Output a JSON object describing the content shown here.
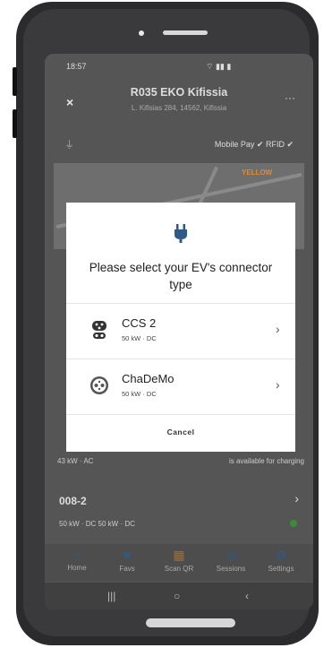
{
  "status": {
    "time": "18:57",
    "right_icons": "wifi-signal-battery"
  },
  "header": {
    "title": "R035 EKO Kifissia",
    "subtitle": "L. Kifisias 284, 14562, Kifissia",
    "close_label": "×",
    "more_label": "···"
  },
  "payments": {
    "text": "Mobile Pay ✔ RFID ✔"
  },
  "map": {
    "poi_label": "YELLOW"
  },
  "dialog": {
    "title": "Please select your EV's connector type",
    "options": [
      {
        "name": "CCS 2",
        "spec": "50 kW · DC",
        "icon": "ccs2-connector-icon"
      },
      {
        "name": "ChaDeMo",
        "spec": "50 kW · DC",
        "icon": "chademo-connector-icon"
      }
    ],
    "cancel_label": "Cancel"
  },
  "background": {
    "row1_power": "43 kW · AC",
    "row1_status": "is available for charging",
    "row2_name": "008-2",
    "row2_connectors": "50 kW · DC    50 kW · DC"
  },
  "tabs": [
    {
      "label": "Home",
      "icon": "home-icon"
    },
    {
      "label": "Favs",
      "icon": "star-icon"
    },
    {
      "label": "Scan QR",
      "icon": "qr-icon"
    },
    {
      "label": "Sessions",
      "icon": "sessions-icon"
    },
    {
      "label": "Settings",
      "icon": "gear-icon"
    }
  ],
  "colors": {
    "accent": "#2e5a88",
    "available": "#3a8c3a",
    "poi": "#e08a30"
  }
}
